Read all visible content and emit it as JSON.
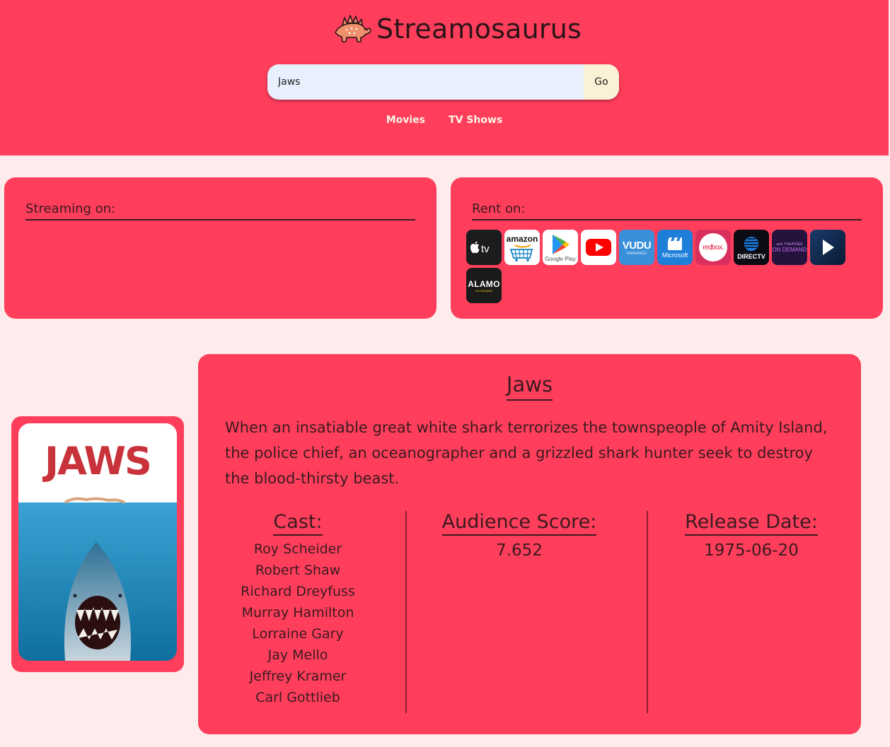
{
  "app": {
    "title": "Streamosaurus",
    "accent_color": "#ff3e5c"
  },
  "search": {
    "value": "Jaws",
    "button_label": "Go"
  },
  "nav": {
    "movies": "Movies",
    "tv_shows": "TV Shows"
  },
  "streaming": {
    "title": "Streaming on:",
    "providers": []
  },
  "rent": {
    "title": "Rent on:",
    "providers": [
      {
        "name": "Apple TV",
        "icon": "apple-tv-icon"
      },
      {
        "name": "Amazon",
        "icon": "amazon-icon",
        "text": "amazon"
      },
      {
        "name": "Google Play",
        "icon": "google-play-icon",
        "text": "Google Play"
      },
      {
        "name": "YouTube",
        "icon": "youtube-icon"
      },
      {
        "name": "Vudu",
        "icon": "vudu-icon",
        "text": "VUDU",
        "subtext": "FANDANGO"
      },
      {
        "name": "Microsoft",
        "icon": "microsoft-icon",
        "text": "Microsoft"
      },
      {
        "name": "Redbox",
        "icon": "redbox-icon",
        "text": "redbox."
      },
      {
        "name": "DirecTV",
        "icon": "directv-icon",
        "text": "DIRECTV"
      },
      {
        "name": "AMC On Demand",
        "icon": "amc-on-demand-icon",
        "text": "ON DEMAND",
        "subtext": "amc THEATRES"
      },
      {
        "name": "Play",
        "icon": "play-icon"
      },
      {
        "name": "Alamo On Demand",
        "icon": "alamo-icon",
        "text": "ALAMO",
        "subtext": "ON DEMAND"
      }
    ]
  },
  "movie": {
    "title": "Jaws",
    "overview": "When an insatiable great white shark terrorizes the townspeople of Amity Island, the police chief, an oceanographer and a grizzled shark hunter seek to destroy the blood-thirsty beast.",
    "cast_label": "Cast:",
    "cast": [
      "Roy Scheider",
      "Robert Shaw",
      "Richard Dreyfuss",
      "Murray Hamilton",
      "Lorraine Gary",
      "Jay Mello",
      "Jeffrey Kramer",
      "Carl Gottlieb"
    ],
    "score_label": "Audience Score:",
    "score": "7.652",
    "release_label": "Release Date:",
    "release_date": "1975-06-20",
    "poster_text": "JAWS"
  }
}
